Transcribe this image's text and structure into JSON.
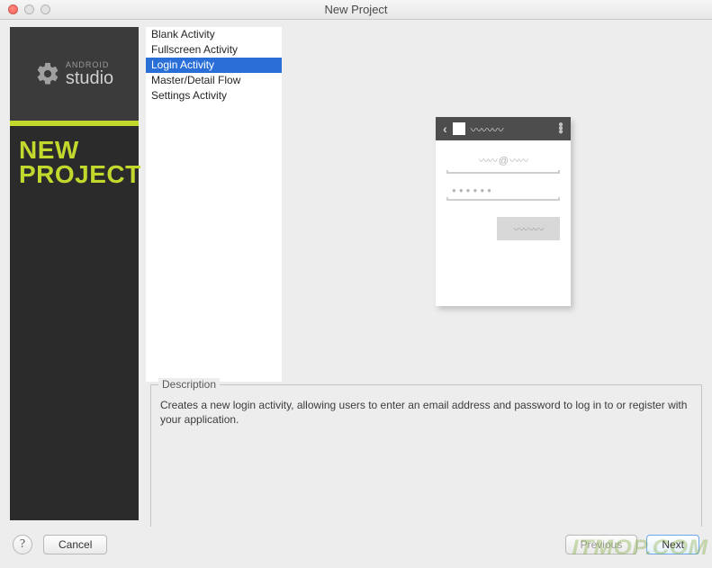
{
  "window": {
    "title": "New Project"
  },
  "sidebar": {
    "logo_top": "ANDROID",
    "logo_bottom": "studio",
    "banner_line1": "NEW",
    "banner_line2": "PROJECT"
  },
  "activities": {
    "items": [
      {
        "label": "Blank Activity",
        "selected": false
      },
      {
        "label": "Fullscreen Activity",
        "selected": false
      },
      {
        "label": "Login Activity",
        "selected": true
      },
      {
        "label": "Master/Detail Flow",
        "selected": false
      },
      {
        "label": "Settings Activity",
        "selected": false
      }
    ]
  },
  "preview": {
    "header_squiggle": "〰〰〰",
    "email_placeholder": "〰〰 @ 〰〰",
    "password_placeholder": "●●●●●●",
    "button_squiggle": "〰〰〰"
  },
  "description": {
    "legend": "Description",
    "text": "Creates a new login activity, allowing users to enter an email address and password to log in to or register with your application."
  },
  "buttons": {
    "help": "?",
    "cancel": "Cancel",
    "previous": "Previous",
    "next": "Next"
  },
  "watermark": "ITMOP.COM"
}
